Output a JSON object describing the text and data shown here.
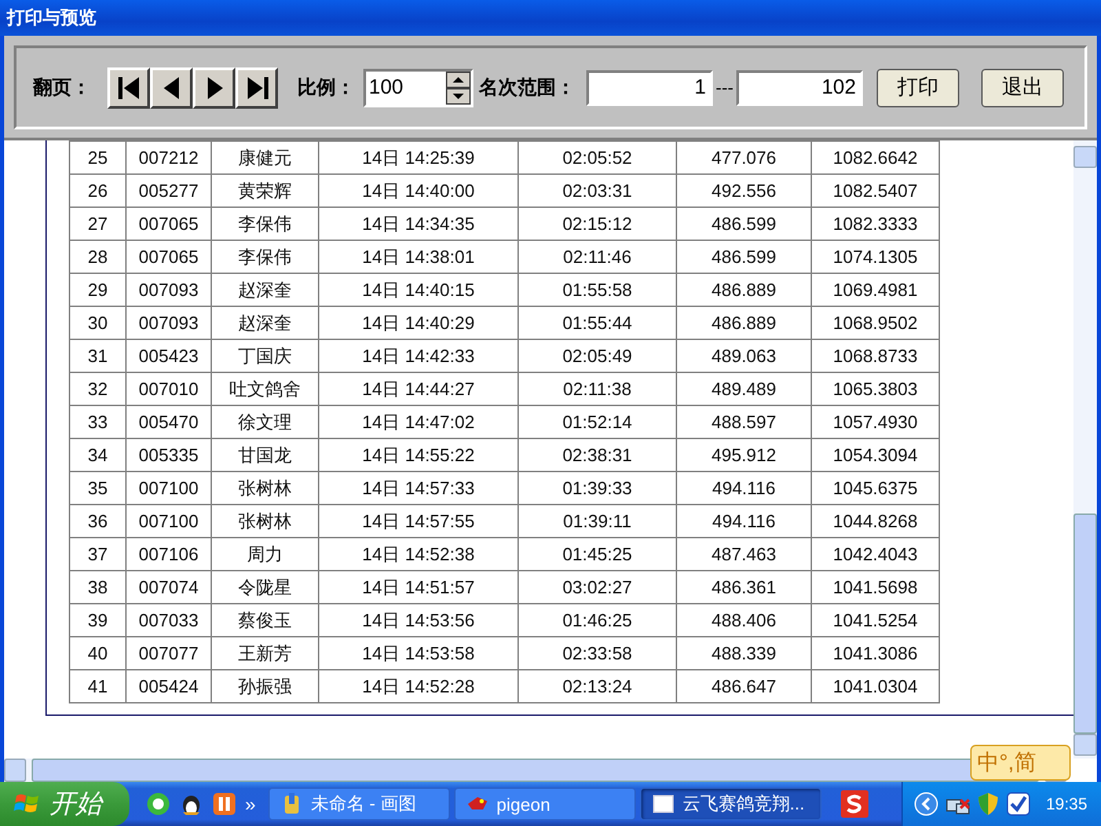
{
  "window": {
    "title": "打印与预览"
  },
  "toolbar": {
    "page_label": "翻页：",
    "scale_label": "比例：",
    "scale_value": "100",
    "range_label": "名次范围：",
    "range_from": "1",
    "range_separator": "---",
    "range_to": "102",
    "buttons": [
      "打印",
      "退出"
    ]
  },
  "table": {
    "rows": [
      [
        "25",
        "007212",
        "康健元",
        "14日 14:25:39",
        "02:05:52",
        "477.076",
        "1082.6642"
      ],
      [
        "26",
        "005277",
        "黄荣辉",
        "14日 14:40:00",
        "02:03:31",
        "492.556",
        "1082.5407"
      ],
      [
        "27",
        "007065",
        "李保伟",
        "14日 14:34:35",
        "02:15:12",
        "486.599",
        "1082.3333"
      ],
      [
        "28",
        "007065",
        "李保伟",
        "14日 14:38:01",
        "02:11:46",
        "486.599",
        "1074.1305"
      ],
      [
        "29",
        "007093",
        "赵深奎",
        "14日 14:40:15",
        "01:55:58",
        "486.889",
        "1069.4981"
      ],
      [
        "30",
        "007093",
        "赵深奎",
        "14日 14:40:29",
        "01:55:44",
        "486.889",
        "1068.9502"
      ],
      [
        "31",
        "005423",
        "丁国庆",
        "14日 14:42:33",
        "02:05:49",
        "489.063",
        "1068.8733"
      ],
      [
        "32",
        "007010",
        "吐文鸽舍",
        "14日 14:44:27",
        "02:11:38",
        "489.489",
        "1065.3803"
      ],
      [
        "33",
        "005470",
        "徐文理",
        "14日 14:47:02",
        "01:52:14",
        "488.597",
        "1057.4930"
      ],
      [
        "34",
        "005335",
        "甘国龙",
        "14日 14:55:22",
        "02:38:31",
        "495.912",
        "1054.3094"
      ],
      [
        "35",
        "007100",
        "张树林",
        "14日 14:57:33",
        "01:39:33",
        "494.116",
        "1045.6375"
      ],
      [
        "36",
        "007100",
        "张树林",
        "14日 14:57:55",
        "01:39:11",
        "494.116",
        "1044.8268"
      ],
      [
        "37",
        "007106",
        "周力",
        "14日 14:52:38",
        "01:45:25",
        "487.463",
        "1042.4043"
      ],
      [
        "38",
        "007074",
        "令陇星",
        "14日 14:51:57",
        "03:02:27",
        "486.361",
        "1041.5698"
      ],
      [
        "39",
        "007033",
        "蔡俊玉",
        "14日 14:53:56",
        "01:46:25",
        "488.406",
        "1041.5254"
      ],
      [
        "40",
        "007077",
        "王新芳",
        "14日 14:53:58",
        "02:33:58",
        "488.339",
        "1041.3086"
      ],
      [
        "41",
        "005424",
        "孙振强",
        "14日 14:52:28",
        "02:13:24",
        "486.647",
        "1041.0304"
      ]
    ]
  },
  "ime_bar": {
    "text": "中°,简"
  },
  "taskbar": {
    "start": "开始",
    "more": "»",
    "tasks": [
      {
        "label": "未命名 - 画图",
        "selected": false
      },
      {
        "label": "pigeon",
        "selected": false
      },
      {
        "label": "云飞赛鸽竞翔...",
        "selected": true
      }
    ],
    "clock": "19:35"
  }
}
